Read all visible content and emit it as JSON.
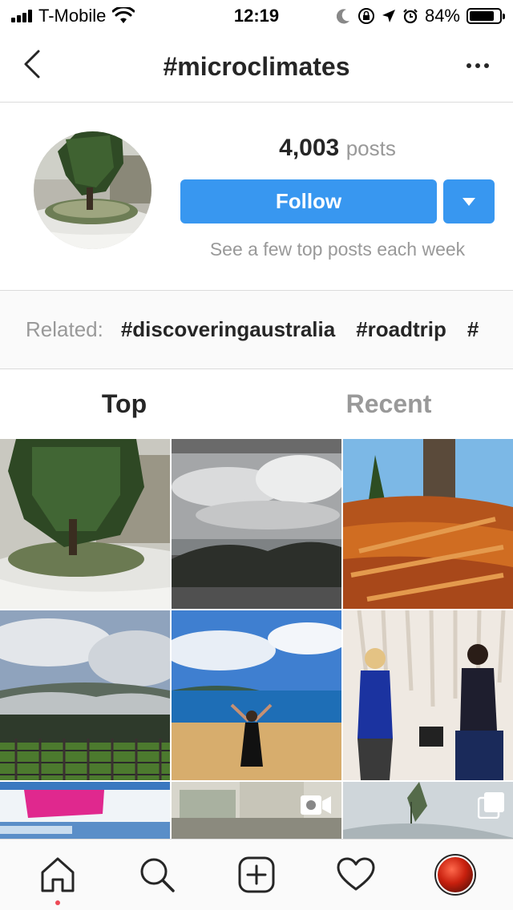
{
  "status_bar": {
    "carrier": "T-Mobile",
    "time": "12:19",
    "battery_percent": "84%",
    "battery_level": 0.84,
    "icons": [
      "signal-icon",
      "wifi-icon",
      "moon-icon",
      "orientation-lock-icon",
      "location-icon",
      "alarm-icon",
      "battery-icon"
    ]
  },
  "nav": {
    "title": "#microclimates",
    "back_icon": "chevron-left-icon",
    "more_icon": "more-options-icon"
  },
  "header": {
    "posts_count": "4,003",
    "posts_label": "posts",
    "follow_label": "Follow",
    "dropdown_icon": "caret-down-icon",
    "follow_subtext": "See a few top posts each week"
  },
  "related": {
    "label": "Related:",
    "tags": [
      "#discoveringaustralia",
      "#roadtrip",
      "#"
    ]
  },
  "tabs": {
    "top": "Top",
    "recent": "Recent",
    "active": "top"
  },
  "grid": {
    "posts": [
      {
        "subject": "snowy tree"
      },
      {
        "subject": "cloudy coastal view"
      },
      {
        "subject": "pine needles close-up"
      },
      {
        "subject": "vineyard with mist"
      },
      {
        "subject": "woman on beach"
      },
      {
        "subject": "two women with wine"
      },
      {
        "subject": "weather map"
      },
      {
        "subject": "window view",
        "badge": "video-icon"
      },
      {
        "subject": "sky and trees",
        "badge": "multiple-posts-icon"
      }
    ]
  },
  "tab_bar": {
    "items": [
      "home-icon",
      "search-icon",
      "new-post-icon",
      "activity-heart-icon",
      "profile-icon"
    ],
    "active": "home-icon"
  },
  "colors": {
    "accent": "#3897f0",
    "text": "#262626",
    "muted": "#999999",
    "notification_dot": "#ed4956"
  }
}
